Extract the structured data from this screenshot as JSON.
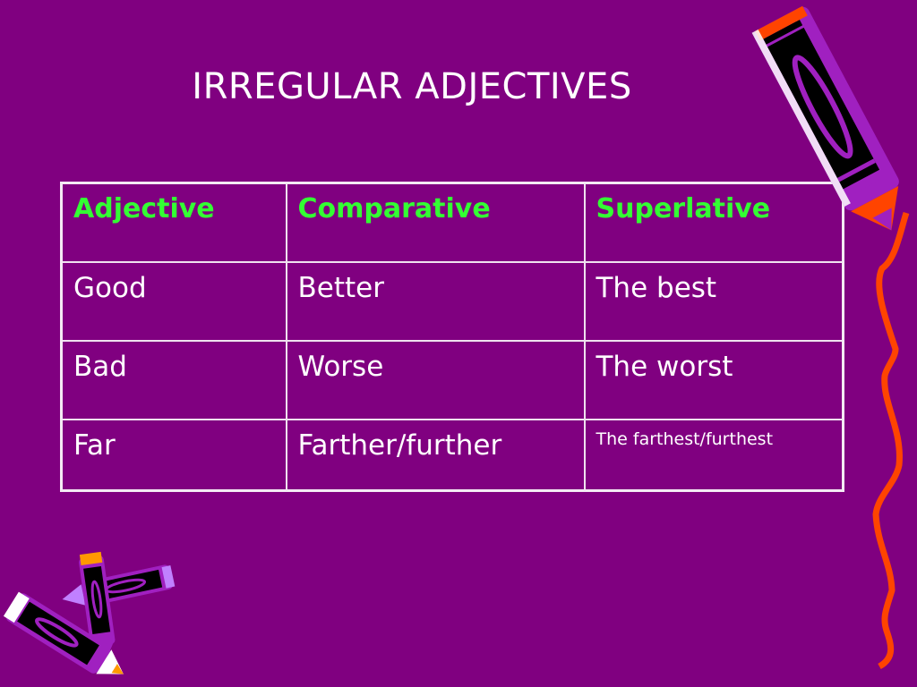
{
  "slide": {
    "title": "IRREGULAR ADJECTIVES",
    "colors": {
      "background": "#800080",
      "header_text": "#33ff33",
      "body_text": "#ffffff",
      "squiggle": "#ff4400"
    },
    "table": {
      "headers": [
        "Adjective",
        "Comparative",
        "Superlative"
      ],
      "rows": [
        [
          "Good",
          "Better",
          "The best"
        ],
        [
          "Bad",
          "Worse",
          "The worst"
        ],
        [
          "Far",
          "Farther/further",
          "The farthest/furthest"
        ]
      ]
    },
    "decorations": [
      "crayon-icon",
      "crossed-crayons-icon",
      "squiggle-line"
    ]
  }
}
